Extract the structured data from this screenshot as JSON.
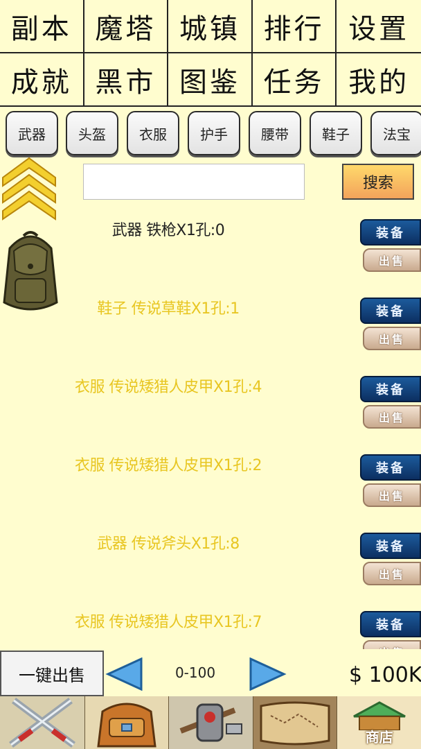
{
  "top_menu": [
    {
      "label": "副本"
    },
    {
      "label": "魔塔"
    },
    {
      "label": "城镇"
    },
    {
      "label": "排行"
    },
    {
      "label": "设置"
    },
    {
      "label": "成就"
    },
    {
      "label": "黑市"
    },
    {
      "label": "图鉴"
    },
    {
      "label": "任务"
    },
    {
      "label": "我的"
    }
  ],
  "category_tabs": [
    {
      "label": "武器"
    },
    {
      "label": "头盔"
    },
    {
      "label": "衣服"
    },
    {
      "label": "护手"
    },
    {
      "label": "腰带"
    },
    {
      "label": "鞋子"
    },
    {
      "label": "法宝"
    }
  ],
  "search": {
    "placeholder": "",
    "value": "",
    "button_label": "搜索"
  },
  "items": [
    {
      "name": "武器 铁枪X1孔:0",
      "color": "#222222",
      "equip_label": "装备",
      "sell_label": "出售"
    },
    {
      "name": "鞋子 传说草鞋X1孔:1",
      "color": "#e8c622",
      "equip_label": "装备",
      "sell_label": "出售"
    },
    {
      "name": "衣服 传说矮猎人皮甲X1孔:4",
      "color": "#e8c622",
      "equip_label": "装备",
      "sell_label": "出售"
    },
    {
      "name": "衣服 传说矮猎人皮甲X1孔:2",
      "color": "#e8c622",
      "equip_label": "装备",
      "sell_label": "出售"
    },
    {
      "name": "武器 传说斧头X1孔:8",
      "color": "#e8c622",
      "equip_label": "装备",
      "sell_label": "出售"
    },
    {
      "name": "衣服 传说矮猎人皮甲X1孔:7",
      "color": "#e8c622",
      "equip_label": "装备",
      "sell_label": "出售"
    }
  ],
  "footer": {
    "sell_all_label": "一键出售",
    "page_range": "0-100",
    "money": "$ 100K"
  },
  "bottom_nav": {
    "shop_label": "商店",
    "icons": [
      "crossed-swords-icon",
      "backpack-icon",
      "crafting-icon",
      "scroll-map-icon",
      "shop-icon"
    ]
  },
  "colors": {
    "background": "#fffdcf",
    "legendary_item": "#e8c622",
    "normal_item": "#222222",
    "equip_button": "#0c2f61",
    "search_button": "#f3a35b"
  }
}
